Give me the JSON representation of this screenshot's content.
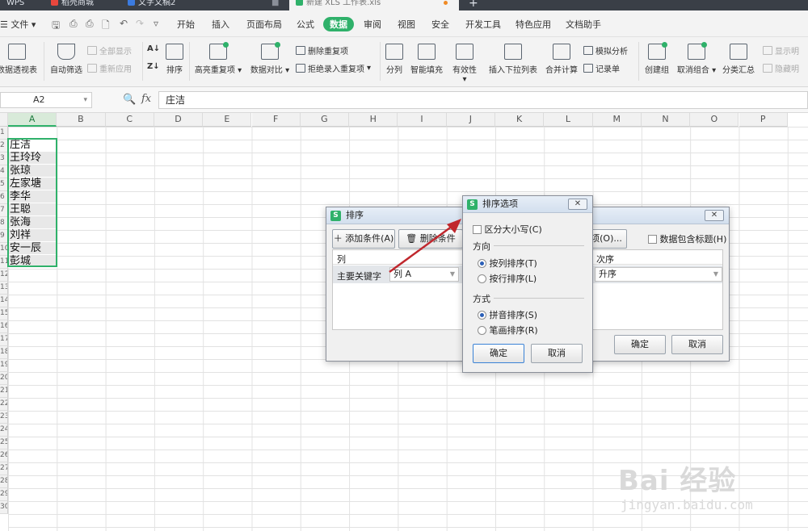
{
  "tabs": [
    {
      "label": "WPS",
      "icon": "wps-icon"
    },
    {
      "label": "稻壳商城",
      "icon": "docer-icon"
    },
    {
      "label": "文字文稿2",
      "icon": "word-doc-icon"
    },
    {
      "label": "新建 XLS 工作表.xls",
      "icon": "sheet-icon"
    }
  ],
  "menu": {
    "file": "文件",
    "items": [
      "开始",
      "插入",
      "页面布局",
      "公式",
      "数据",
      "审阅",
      "视图",
      "安全",
      "开发工具",
      "特色应用",
      "文档助手"
    ],
    "active": "数据"
  },
  "ribbon": {
    "pivot": "数据透视表",
    "autofilter": "自动筛选",
    "show_all": "全部显示",
    "reapply": "重新应用",
    "sort": "排序",
    "highlight_dup": "高亮重复项",
    "data_compare": "数据对比",
    "remove_dup": "删除重复项",
    "reject_dup": "拒绝录入重复项",
    "split": "分列",
    "smart_fill": "智能填充",
    "validity": "有效性",
    "insert_dropdown": "插入下拉列表",
    "consolidate": "合并计算",
    "simulate": "模拟分析",
    "record": "记录单",
    "create_group": "创建组",
    "ungroup": "取消组合",
    "subtotal": "分类汇总",
    "show_detail": "显示明",
    "hide_detail": "隐藏明"
  },
  "formula_bar": {
    "name_box": "A2",
    "fx": "fx",
    "content": "庄洁"
  },
  "columns": [
    "A",
    "B",
    "C",
    "D",
    "E",
    "F",
    "G",
    "H",
    "I",
    "J",
    "K",
    "L",
    "M",
    "N",
    "O",
    "P"
  ],
  "rows": [
    "1",
    "2",
    "3",
    "4",
    "5",
    "6",
    "7",
    "8",
    "9",
    "10",
    "11",
    "12",
    "13",
    "14",
    "15",
    "16",
    "17",
    "18",
    "19",
    "20",
    "21",
    "22",
    "23",
    "24",
    "25",
    "26",
    "27",
    "28",
    "29",
    "30"
  ],
  "cells": [
    "庄洁",
    "王玲玲",
    "张琼",
    "左家塘",
    "李华",
    "王聪",
    "张海",
    "刘祥",
    "安一辰",
    "彭城"
  ],
  "sort_dialog": {
    "title": "排序",
    "add_condition": "添加条件(A)",
    "delete_condition": "删除条件(D)",
    "options_button": "选项(O)...",
    "header_checkbox": "数据包含标题(H)",
    "col_header": "列",
    "order_header": "次序",
    "primary_key_label": "主要关键字",
    "primary_key_value": "列 A",
    "order_value": "升序",
    "ok": "确定",
    "cancel": "取消"
  },
  "options_dialog": {
    "title": "排序选项",
    "case_sensitive": "区分大小写(C)",
    "direction_label": "方向",
    "by_column": "按列排序(T)",
    "by_row": "按行排序(L)",
    "method_label": "方式",
    "pinyin": "拼音排序(S)",
    "stroke": "笔画排序(R)",
    "ok": "确定",
    "cancel": "取消"
  },
  "watermark": {
    "brand": "Bai 经验",
    "url": "jingyan.baidu.com"
  },
  "colors": {
    "accent": "#2fb16a",
    "arrow": "#c0272d",
    "tabbar": "#3a3f47"
  }
}
